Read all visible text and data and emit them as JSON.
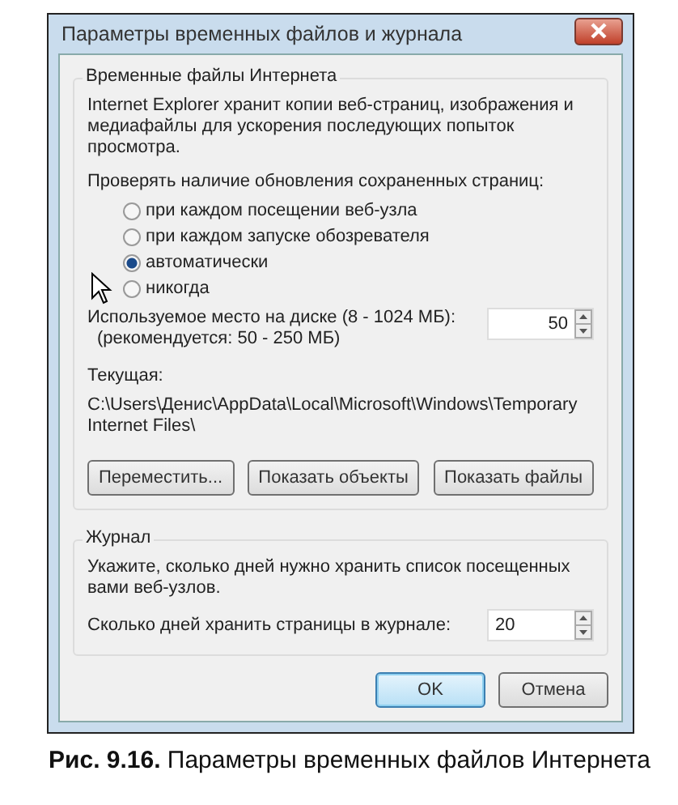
{
  "window": {
    "title": "Параметры временных файлов и журнала"
  },
  "cache_group": {
    "title": "Временные файлы Интернета",
    "description": "Internet Explorer хранит копии веб-страниц, изображения и медиафайлы для ускорения последующих попыток просмотра.",
    "check_label": "Проверять наличие обновления сохраненных страниц:",
    "options": [
      {
        "label": "при каждом посещении веб-узла",
        "selected": false
      },
      {
        "label": "при каждом запуске обозревателя",
        "selected": false
      },
      {
        "label": "автоматически",
        "selected": true
      },
      {
        "label": "никогда",
        "selected": false
      }
    ],
    "disk_label": "Используемое место на диске (8 - 1024 МБ):",
    "disk_hint": "(рекомендуется: 50 - 250 МБ)",
    "disk_value": "50",
    "current_label": "Текущая:",
    "current_path": "C:\\Users\\Денис\\AppData\\Local\\Microsoft\\Windows\\Temporary Internet Files\\",
    "buttons": [
      "Переместить...",
      "Показать объекты",
      "Показать файлы"
    ]
  },
  "history_group": {
    "title": "Журнал",
    "description": "Укажите, сколько дней нужно хранить список посещенных вами веб-узлов.",
    "days_label": "Сколько дней хранить страницы в журнале:",
    "days_value": "20"
  },
  "buttons": [
    {
      "label": "OK",
      "default": true
    },
    {
      "label": "Отмена",
      "default": false
    }
  ],
  "caption": "**Рис. 9.16.** Параметры временных файлов Интернета"
}
